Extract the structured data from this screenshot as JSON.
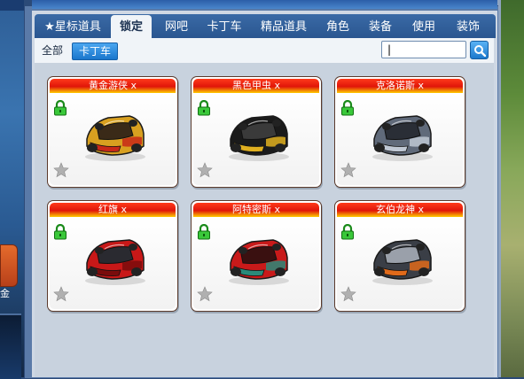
{
  "tabs": [
    {
      "label": "★星标道具",
      "active": false
    },
    {
      "label": "锁定",
      "active": true
    },
    {
      "label": "网吧",
      "active": false
    },
    {
      "label": "卡丁车",
      "active": false
    },
    {
      "label": "精品道具",
      "active": false
    },
    {
      "label": "角色",
      "active": false
    },
    {
      "label": "装备",
      "active": false
    },
    {
      "label": "使用",
      "active": false
    },
    {
      "label": "装饰",
      "active": false
    }
  ],
  "filter": {
    "all_label": "全部",
    "selected_label": "卡丁车"
  },
  "search": {
    "value": "|",
    "placeholder": ""
  },
  "left_side_label": "金",
  "items": [
    {
      "name": "黄金游侠 x",
      "locked": true,
      "starred": false,
      "colors": [
        "#d8a020",
        "#c82818",
        "#3a2a18"
      ]
    },
    {
      "name": "黑色甲虫 x",
      "locked": true,
      "starred": false,
      "colors": [
        "#1a1a1a",
        "#e0b020",
        "#3a3a3a"
      ]
    },
    {
      "name": "克洛诺斯 x",
      "locked": true,
      "starred": false,
      "colors": [
        "#606a7a",
        "#c0c8d4",
        "#2a2e36"
      ]
    },
    {
      "name": "红旗 x",
      "locked": true,
      "starred": false,
      "colors": [
        "#c81818",
        "#7a0c0c",
        "#2a2a30"
      ]
    },
    {
      "name": "阿特密斯 x",
      "locked": true,
      "starred": false,
      "colors": [
        "#c81a1a",
        "#2a8a7a",
        "#3a1010"
      ]
    },
    {
      "name": "玄伯龙神 x",
      "locked": true,
      "starred": false,
      "colors": [
        "#3a3e46",
        "#e06a1a",
        "#9aa0aa"
      ]
    }
  ]
}
